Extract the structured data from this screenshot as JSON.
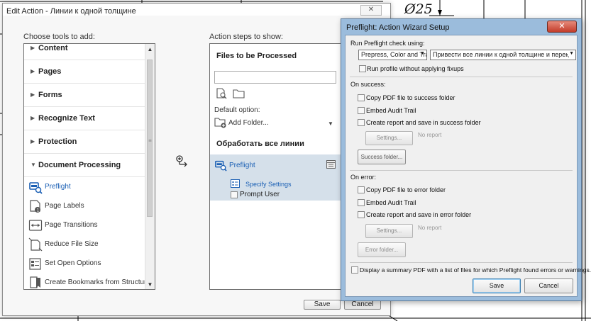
{
  "background": {
    "dimension_label": "Ø25"
  },
  "edit_action": {
    "title": "Edit Action - Линии к одной толщине",
    "close_glyph": "✕",
    "tools_label": "Choose tools to add:",
    "steps_label": "Action steps to show:",
    "categories": [
      {
        "label": "Content"
      },
      {
        "label": "Pages"
      },
      {
        "label": "Forms"
      },
      {
        "label": "Recognize Text"
      },
      {
        "label": "Protection"
      },
      {
        "label": "Document Processing"
      }
    ],
    "tools": [
      {
        "label": "Preflight",
        "icon": "preflight-icon"
      },
      {
        "label": "Page Labels",
        "icon": "page-labels-icon"
      },
      {
        "label": "Page Transitions",
        "icon": "page-transitions-icon"
      },
      {
        "label": "Reduce File Size",
        "icon": "reduce-file-size-icon"
      },
      {
        "label": "Set Open Options",
        "icon": "set-open-options-icon"
      },
      {
        "label": "Create Bookmarks from Structure",
        "icon": "create-bookmarks-icon"
      }
    ],
    "steps": {
      "files_title": "Files to be Processed",
      "default_option_label": "Default option:",
      "add_folder_label": "Add Folder...",
      "group_title": "Обработать все линии",
      "step_label": "Preflight",
      "specify_settings_label": "Specify Settings",
      "prompt_user_label": "Prompt User"
    },
    "save_label": "Save",
    "cancel_label": "Cancel"
  },
  "preflight": {
    "title": "Preflight: Action Wizard Setup",
    "run_label": "Run Preflight check using:",
    "profile_category": "Prepress, Color and Tran",
    "profile_name": "Привести все линии к одной толщине и перекрасить",
    "run_without_fixups_label": "Run profile without applying fixups",
    "on_success_label": "On success:",
    "success_copy_label": "Copy PDF file to success folder",
    "success_audit_label": "Embed Audit Trail",
    "success_report_label": "Create report and save in success folder",
    "success_settings_label": "Settings...",
    "success_no_report": "No report",
    "success_folder_label": "Success folder...",
    "on_error_label": "On error:",
    "error_copy_label": "Copy PDF file to error folder",
    "error_audit_label": "Embed Audit Trail",
    "error_report_label": "Create report and save in error folder",
    "error_settings_label": "Settings...",
    "error_no_report": "No report",
    "error_folder_label": "Error folder...",
    "summary_label": "Display a summary PDF with a list of files for which Preflight found errors or warnings.",
    "save_label": "Save",
    "cancel_label": "Cancel"
  }
}
